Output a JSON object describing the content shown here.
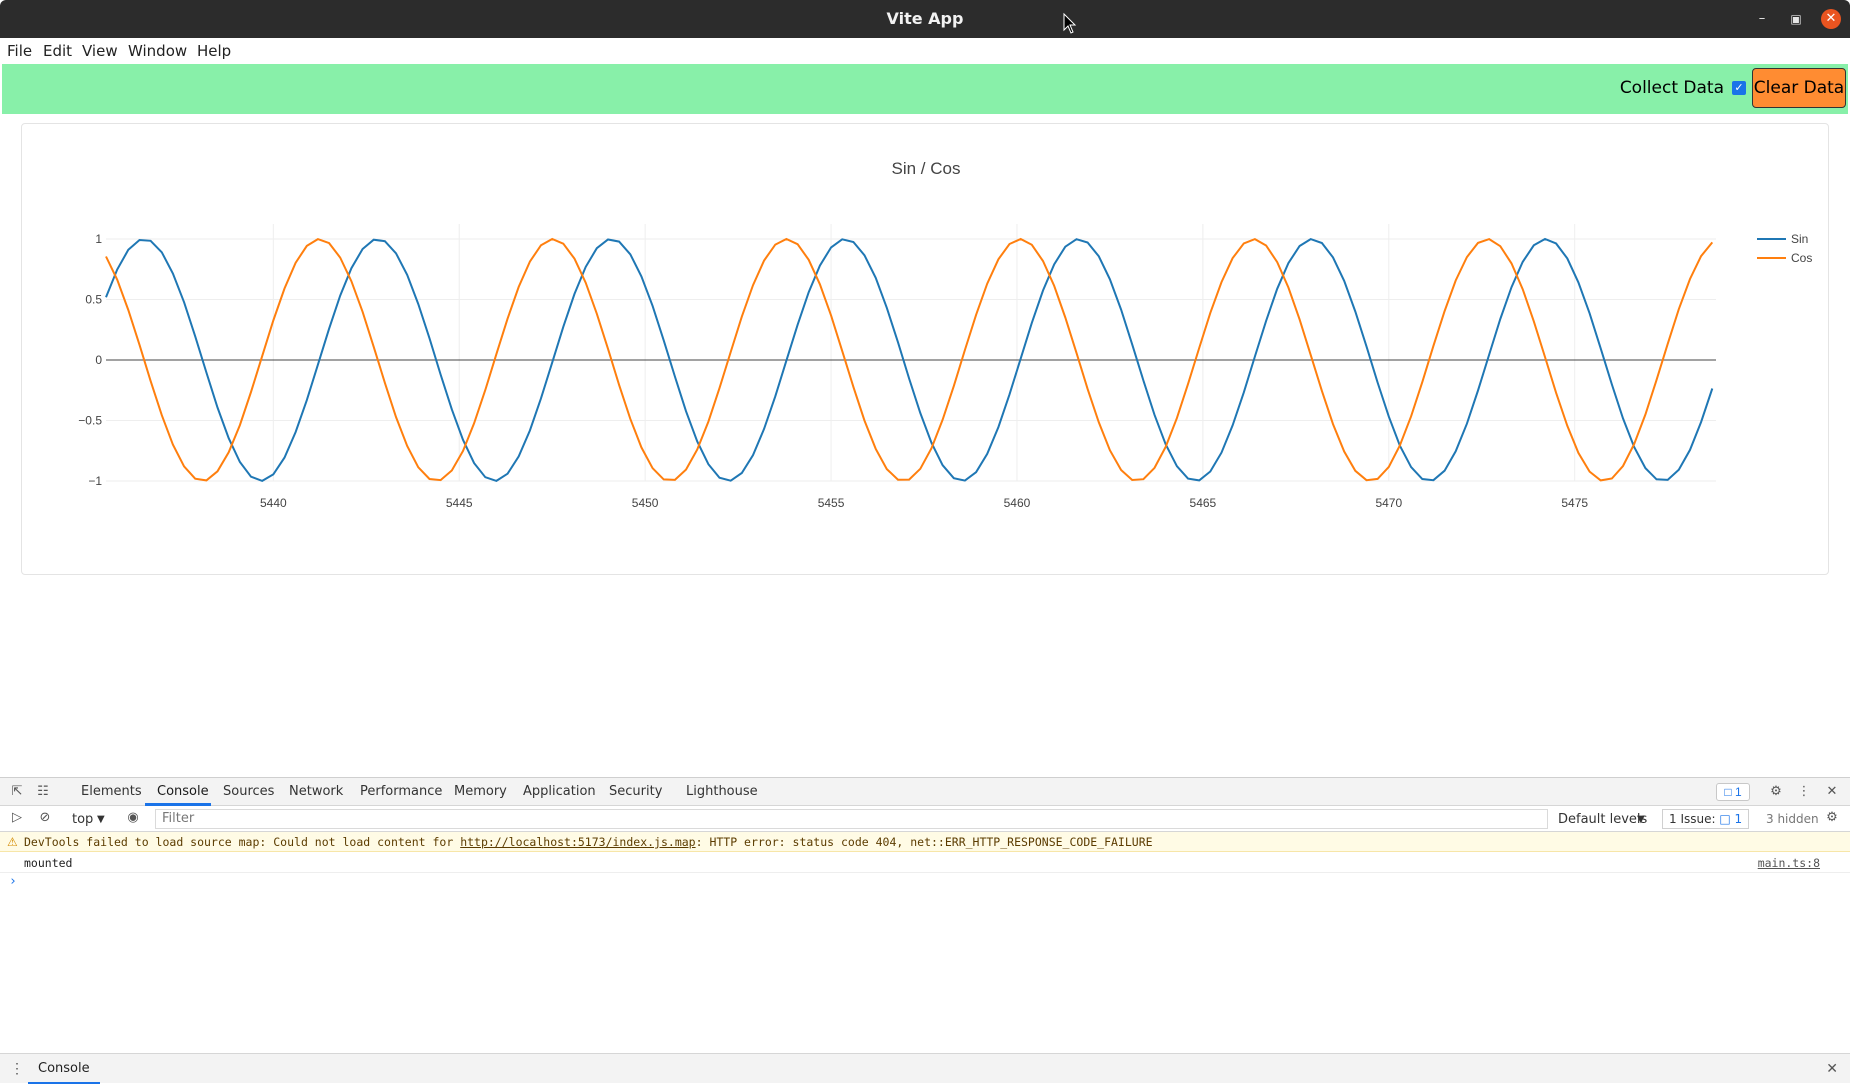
{
  "window": {
    "title": "Vite App"
  },
  "menu": [
    "File",
    "Edit",
    "View",
    "Window",
    "Help"
  ],
  "toolbar": {
    "collect_label": "Collect Data",
    "collect_checked": true,
    "clear_label": "Clear Data",
    "accent": "#88f0a9",
    "button_color": "#ff8c32"
  },
  "chart_data": {
    "type": "line",
    "title": "Sin / Cos",
    "xlabel": "",
    "ylabel": "",
    "xlim": [
      5435.5,
      5478.8
    ],
    "ylim": [
      -1,
      1
    ],
    "x_ticks": [
      5440,
      5445,
      5450,
      5455,
      5460,
      5465,
      5470,
      5475
    ],
    "y_ticks": [
      1,
      0.5,
      0,
      -0.5,
      -1
    ],
    "y_tick_labels": [
      "1",
      "0.5",
      "0",
      "−0.5",
      "−1"
    ],
    "x_step": 0.3,
    "legend_position": "top-right",
    "grid": true,
    "series": [
      {
        "name": "Sin",
        "color": "#1f77b4",
        "function": "sin"
      },
      {
        "name": "Cos",
        "color": "#ff7f0e",
        "function": "cos"
      }
    ]
  },
  "devtools": {
    "tabs": [
      "Elements",
      "Console",
      "Sources",
      "Network",
      "Performance",
      "Memory",
      "Application",
      "Security",
      "Lighthouse"
    ],
    "active_tab": "Console",
    "badge": "1",
    "context": "top",
    "filter_placeholder": "Filter",
    "levels": "Default levels",
    "issues": "1 Issue:",
    "issues_count": "1",
    "hidden": "3 hidden",
    "warning": {
      "prefix": "DevTools failed to load source map: Could not load content for ",
      "link": "http://localhost:5173/index.js.map",
      "suffix": ": HTTP error: status code 404, net::ERR_HTTP_RESPONSE_CODE_FAILURE"
    },
    "log": {
      "message": "mounted",
      "source": "main.ts:8"
    },
    "drawer_tab": "Console"
  }
}
